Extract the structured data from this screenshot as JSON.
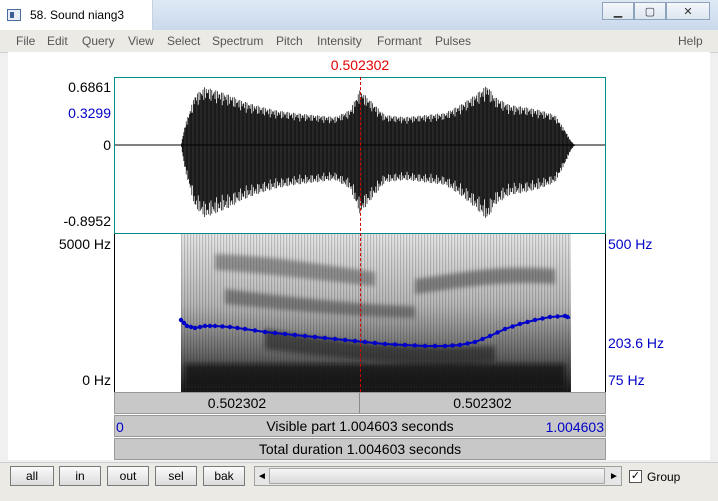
{
  "window": {
    "title": "58. Sound niang3",
    "controls": [
      "minimize-icon",
      "maximize-icon",
      "close-icon"
    ]
  },
  "menu": {
    "items": [
      "File",
      "Edit",
      "Query",
      "View",
      "Select",
      "Spectrum",
      "Pitch",
      "Intensity",
      "Formant",
      "Pulses"
    ],
    "help": "Help"
  },
  "cursor": {
    "time_label": "0.502302",
    "time_s": 0.502302,
    "color": "#e00000"
  },
  "waveform": {
    "y_max": "0.6861",
    "y_sample": "0.3299",
    "y_zero": "0",
    "y_min": "-0.8952"
  },
  "spectrogram": {
    "freq_top": "5000 Hz",
    "freq_bottom": "0 Hz",
    "pitch_top": "500 Hz",
    "pitch_value": "203.6 Hz",
    "pitch_bottom": "75 Hz",
    "pitch_color": "#0000c8"
  },
  "time_bar": {
    "left_segment": "0.502302",
    "right_segment": "0.502302"
  },
  "visible_bar": {
    "start": "0",
    "label": "Visible part 1.004603 seconds",
    "end": "1.004603"
  },
  "total_bar": {
    "label": "Total duration 1.004603 seconds"
  },
  "buttons": {
    "all": "all",
    "in": "in",
    "out": "out",
    "sel": "sel",
    "bak": "bak"
  },
  "group": {
    "label": "Group",
    "checked": true,
    "mark": "✓"
  },
  "scroll": {
    "left_arrow": "◄",
    "right_arrow": "►"
  }
}
